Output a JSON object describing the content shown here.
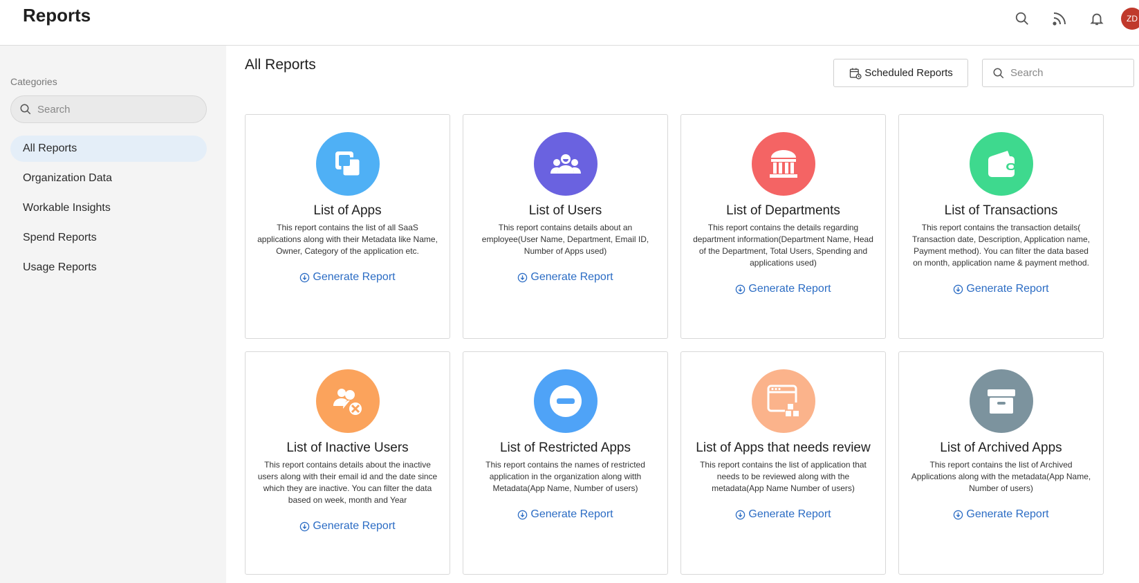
{
  "header": {
    "title": "Reports",
    "avatar_initials": "ZD"
  },
  "sidebar": {
    "heading": "Categories",
    "search_placeholder": "Search",
    "items": [
      {
        "label": "All Reports",
        "active": true
      },
      {
        "label": "Organization Data",
        "active": false
      },
      {
        "label": "Workable Insights",
        "active": false
      },
      {
        "label": "Spend Reports",
        "active": false
      },
      {
        "label": "Usage Reports",
        "active": false
      }
    ]
  },
  "main": {
    "title": "All Reports",
    "scheduled_label": "Scheduled Reports",
    "search_placeholder": "Search",
    "cards": [
      {
        "title": "List of Apps",
        "description": "This report contains the list of all SaaS applications along with their Metadata like Name, Owner, Category of the application etc.",
        "link": "Generate Report",
        "icon": "apps-icon",
        "color": "#4fb0f5"
      },
      {
        "title": "List of Users",
        "description": "This report contains details about an employee(User Name, Department, Email ID, Number of Apps used)",
        "link": "Generate Report",
        "icon": "users-icon",
        "color": "#6a62e0"
      },
      {
        "title": "List of Departments",
        "description": "This report contains the details regarding department information(Department Name, Head of the Department, Total Users, Spending and applications used)",
        "link": "Generate Report",
        "icon": "building-icon",
        "color": "#f46464"
      },
      {
        "title": "List of Transactions",
        "description": "This report contains the transaction details( Transaction date, Description, Application name, Payment method). You can filter the data based on month, application name & payment method.",
        "link": "Generate Report",
        "icon": "wallet-icon",
        "color": "#3ed98e"
      },
      {
        "title": "List of Inactive Users",
        "description": "This report contains details about the inactive users along with their email id and the date since which they are inactive. You can filter the data based on week, month and Year",
        "link": "Generate Report",
        "icon": "inactive-user-icon",
        "color": "#fba35c"
      },
      {
        "title": "List of Restricted Apps",
        "description": "This report contains the names of restricted application in the organization along witth Metadata(App Name, Number of users)",
        "link": "Generate Report",
        "icon": "restricted-icon",
        "color": "#4fa3f7"
      },
      {
        "title": "List of Apps that needs review",
        "description": "This report contains the list of application that needs to be reviewed along with the metadata(App Name Number of users)",
        "link": "Generate Report",
        "icon": "review-apps-icon",
        "color": "#fbb38b"
      },
      {
        "title": "List of Archived Apps",
        "description": "This report contains the list of Archived Applications along with the metadata(App Name, Number of users)",
        "link": "Generate Report",
        "icon": "archive-icon",
        "color": "#7c939e"
      }
    ]
  }
}
